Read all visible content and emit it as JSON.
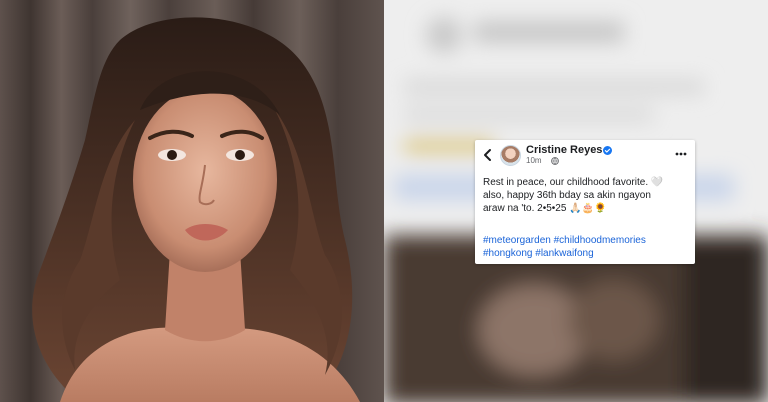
{
  "post": {
    "author": "Cristine Reyes",
    "time": "10m",
    "text_lines": [
      "Rest in peace, our childhood favorite. 🤍",
      "also, happy 36th bday sa akin ngayon",
      "araw na 'to. 2•5•25 🙏🏻🎂🌻"
    ],
    "hashtag_lines": [
      "#meteorgarden #childhoodmemories",
      "#hongkong #lankwaifong"
    ]
  },
  "icons": {
    "back": "chevron-left-icon",
    "verified": "verified-badge-icon",
    "audience": "globe-icon",
    "more": "more-options-icon"
  },
  "colors": {
    "verified": "#1877f2",
    "hashtag": "#1b64d8",
    "meta": "#65676b",
    "text": "#1c1e21"
  }
}
